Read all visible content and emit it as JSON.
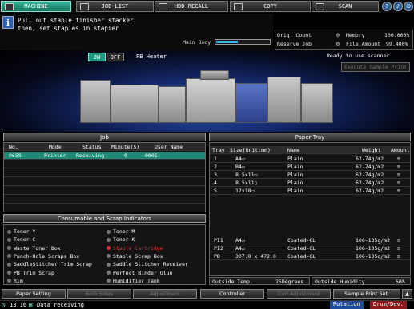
{
  "tabs": [
    {
      "label": "MACHINE",
      "active": true
    },
    {
      "label": "JOB LIST"
    },
    {
      "label": "HDD RECALL"
    },
    {
      "label": "COPY"
    },
    {
      "label": "SCAN"
    }
  ],
  "message": {
    "line1": "Pull out staple finisher stacker",
    "line2": "then, set staples in stapler"
  },
  "main_body": {
    "label": "Main Body",
    "level": 0.4
  },
  "counters": {
    "orig_count_label": "Orig. Count",
    "orig_count": "0",
    "memory_label": "Memory",
    "memory": "100.000%",
    "reserve_job_label": "Reserve Job",
    "reserve_job": "0",
    "file_amount_label": "File Amount",
    "file_amount": "99.400%"
  },
  "pb_heater": {
    "on": "ON",
    "off": "OFF",
    "label": "PB Heater"
  },
  "scanner_status": "Ready to use scanner",
  "execute_sample": "Execute Sample Print",
  "job": {
    "title": "Job",
    "headers": [
      "No.",
      "Mode",
      "Status",
      "Minute(S)",
      "User Name"
    ],
    "rows": [
      {
        "no": "0658",
        "mode": "Printer",
        "status": "Receiving",
        "minute": "0",
        "user": "0001"
      }
    ]
  },
  "paper_tray": {
    "title": "Paper Tray",
    "headers": [
      "Tray",
      "Size(Unit:mm)",
      "Name",
      "Weight",
      "Amount"
    ],
    "rows": [
      {
        "tray": "1",
        "size": "A4▭",
        "name": "Plain",
        "weight": "62-74g/m2"
      },
      {
        "tray": "2",
        "size": "B4▭",
        "name": "Plain",
        "weight": "62-74g/m2"
      },
      {
        "tray": "3",
        "size": "8.5x11▭",
        "name": "Plain",
        "weight": "62-74g/m2"
      },
      {
        "tray": "4",
        "size": "8.5x11▯",
        "name": "Plain",
        "weight": "62-74g/m2"
      },
      {
        "tray": "5",
        "size": "12x18▭",
        "name": "Plain",
        "weight": "62-74g/m2"
      }
    ],
    "inserter_rows": [
      {
        "tray": "PI1",
        "size": "A4▭",
        "name": "Coated-GL",
        "weight": "106-135g/m2"
      },
      {
        "tray": "PI2",
        "size": "A4▭",
        "name": "Coated-GL",
        "weight": "106-135g/m2"
      },
      {
        "tray": "PB",
        "size": "307.0 x 472.0",
        "name": "Coated-GL",
        "weight": "106-135g/m2"
      }
    ],
    "outside_temp_label": "Outside Temp.",
    "outside_temp": "25Degrees",
    "outside_humidity_label": "Outside Humidity",
    "outside_humidity": "50%"
  },
  "consumables": {
    "title": "Consumable and Scrap Indicators",
    "items": [
      {
        "label": "Toner Y"
      },
      {
        "label": "Toner M"
      },
      {
        "label": "Toner C"
      },
      {
        "label": "Toner K"
      },
      {
        "label": "Waste Toner Box"
      },
      {
        "label": "Staple Cartridge",
        "alert": true
      },
      {
        "label": "Punch-Hole Scraps Box"
      },
      {
        "label": "Staple Scrap Box"
      },
      {
        "label": "SaddleStitcher Trim Scrap"
      },
      {
        "label": "Saddle Stitcher Receiver"
      },
      {
        "label": "PB Trim Scrap"
      },
      {
        "label": "Perfect Binder Glue"
      },
      {
        "label": "Rim"
      },
      {
        "label": "Humidifier Tank"
      }
    ]
  },
  "bottom": {
    "paper_setting": "Paper Setting",
    "both_sides": "Both Sides",
    "adjustment": "Adjustment",
    "controller": "Controller",
    "curl_adjustment": "Curl Adjustment",
    "sample_print_set": "Sample Print Set."
  },
  "status_bar": {
    "time": "13:16",
    "text": "Data receiving",
    "rotation": "Rotation",
    "drum": "Drum/Dev."
  },
  "colors": {
    "accent": "#1f9a80",
    "alert": "#e03030",
    "selected_row": "#1f8a78"
  }
}
